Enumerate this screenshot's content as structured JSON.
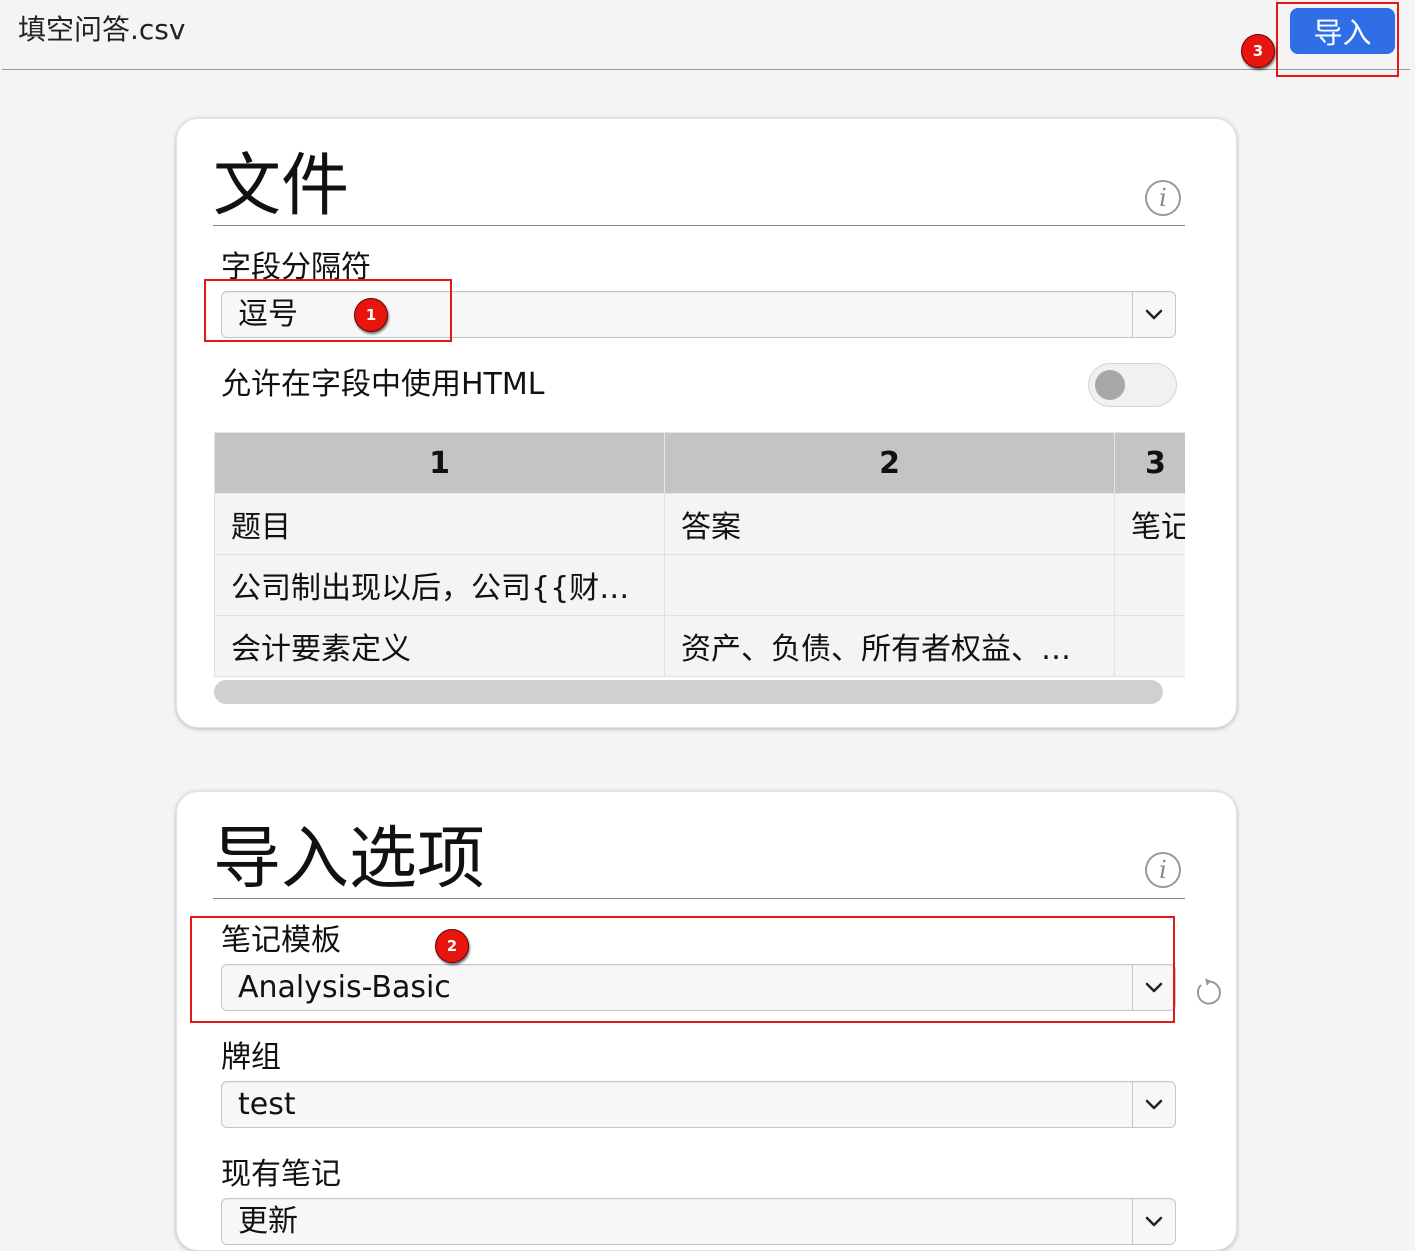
{
  "header": {
    "file_name": "填空问答.csv",
    "import_button": "导入"
  },
  "badges": [
    "1",
    "2",
    "3"
  ],
  "file_section": {
    "title": "文件",
    "info_glyph": "i",
    "delimiter_label": "字段分隔符",
    "delimiter_value": "逗号",
    "allow_html_label": "允许在字段中使用HTML",
    "allow_html_on": false,
    "preview": {
      "headers": [
        "1",
        "2",
        "3"
      ],
      "rows": [
        [
          "题目",
          "答案",
          "笔记"
        ],
        [
          "公司制出现以后，公司{{财产…",
          "",
          ""
        ],
        [
          "会计要素定义",
          "资产、负债、所有者权益、收…",
          ""
        ]
      ]
    }
  },
  "import_section": {
    "title": "导入选项",
    "info_glyph": "i",
    "notetype_label": "笔记模板",
    "notetype_value": "Analysis-Basic",
    "deck_label": "牌组",
    "deck_value": "test",
    "existing_label": "现有笔记",
    "existing_value": "更新"
  },
  "icons": {
    "info": "info-icon",
    "chevron": "chevron-down-icon",
    "reset": "reset-icon"
  },
  "colors": {
    "accent": "#2f6ee6",
    "annotation_red": "#e01818",
    "badge_red": "#e8140e"
  }
}
